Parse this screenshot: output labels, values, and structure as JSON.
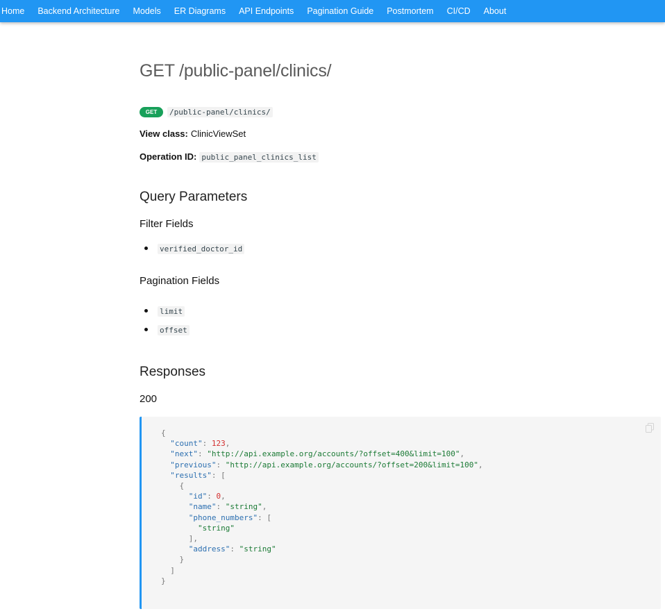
{
  "nav": {
    "items": [
      "Home",
      "Backend Architecture",
      "Models",
      "ER Diagrams",
      "API Endpoints",
      "Pagination Guide",
      "Postmortem",
      "CI/CD",
      "About"
    ]
  },
  "page": {
    "title": "GET /public-panel/clinics/",
    "method_badge": "GET",
    "path": "/public-panel/clinics/",
    "view_class_label": "View class:",
    "view_class": "ClinicViewSet",
    "operation_id_label": "Operation ID:",
    "operation_id": "public_panel_clinics_list"
  },
  "query": {
    "heading": "Query Parameters",
    "filter_heading": "Filter Fields",
    "filter_fields": [
      "verified_doctor_id"
    ],
    "pagination_heading": "Pagination Fields",
    "pagination_fields": [
      "limit",
      "offset"
    ]
  },
  "responses": {
    "heading": "Responses",
    "status": "200",
    "example": {
      "count_key": "\"count\"",
      "count_val": "123",
      "next_key": "\"next\"",
      "next_val": "\"http://api.example.org/accounts/?offset=400&limit=100\"",
      "previous_key": "\"previous\"",
      "previous_val": "\"http://api.example.org/accounts/?offset=200&limit=100\"",
      "results_key": "\"results\"",
      "id_key": "\"id\"",
      "id_val": "0",
      "name_key": "\"name\"",
      "name_val": "\"string\"",
      "phone_key": "\"phone_numbers\"",
      "phone_item": "\"string\"",
      "address_key": "\"address\"",
      "address_val": "\"string\""
    }
  },
  "icons": {
    "copy": "copy-icon"
  }
}
